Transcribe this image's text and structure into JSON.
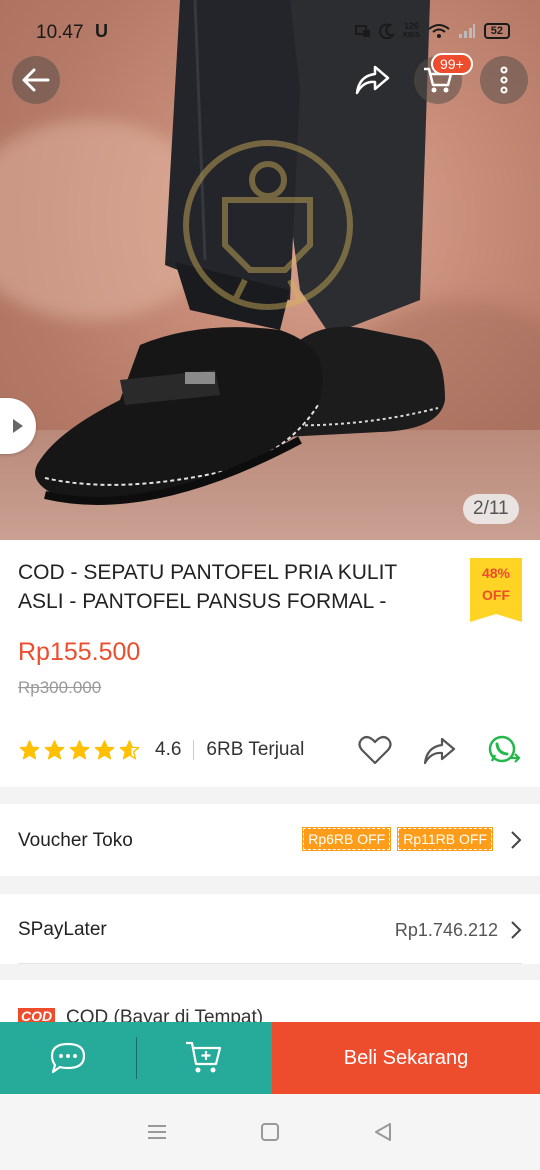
{
  "status": {
    "time": "10.47",
    "carrier_icon": "U",
    "speed_value": "126",
    "speed_unit": "KB/S",
    "battery": "52"
  },
  "hero": {
    "cart_badge": "99+",
    "image_counter": "2/11"
  },
  "product": {
    "title": "COD - SEPATU PANTOFEL PRIA KULIT ASLI - PANTOFEL PANSUS FORMAL -",
    "discount_percent": "48%",
    "discount_label": "OFF",
    "price": "Rp155.500",
    "original_price": "Rp300.000",
    "rating": "4.6",
    "rating_stars_fraction": 0.92,
    "sold": "6RB Terjual"
  },
  "voucher": {
    "label": "Voucher Toko",
    "tags": [
      "Rp6RB OFF",
      "Rp11RB OFF"
    ]
  },
  "spaylater": {
    "label": "SPayLater",
    "value": "Rp1.746.212"
  },
  "cod": {
    "logo": "COD",
    "text": "COD (Bayar di Tempat)"
  },
  "bottom_bar": {
    "buy_label": "Beli Sekarang"
  },
  "colors": {
    "accent": "#ee4d2d",
    "teal": "#26aa99",
    "star": "#ffc000",
    "whatsapp": "#25b74a"
  },
  "icons": [
    "back-arrow-icon",
    "share-icon",
    "cart-icon",
    "more-vertical-icon",
    "play-icon",
    "star-icon",
    "heart-icon",
    "share-icon",
    "whatsapp-icon",
    "chevron-right-icon",
    "chat-icon",
    "add-to-cart-icon",
    "menu-icon",
    "home-square-icon",
    "back-triangle-icon"
  ]
}
